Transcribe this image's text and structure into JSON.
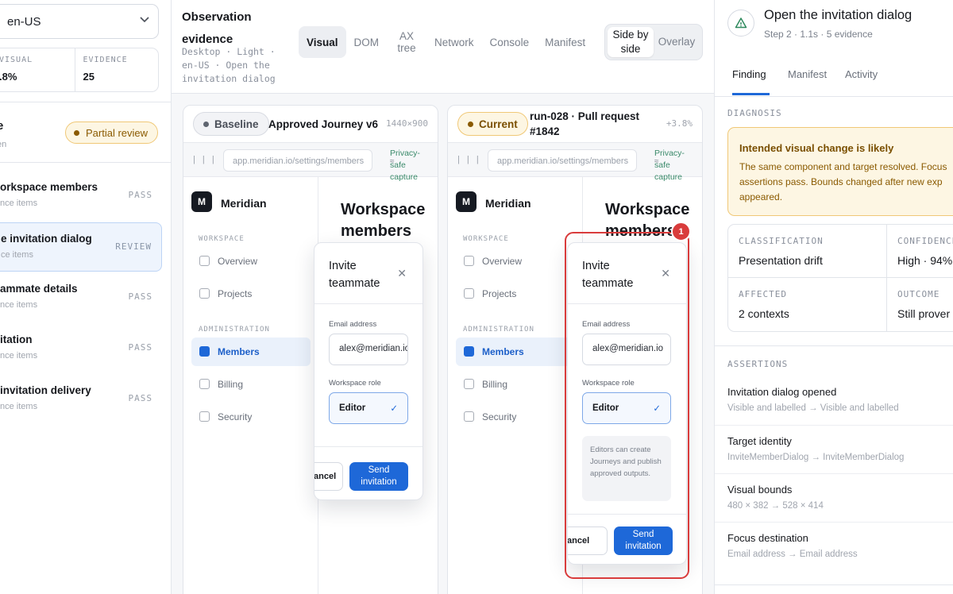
{
  "left": {
    "locale": "en-US",
    "stats": [
      {
        "label": "VISUAL",
        "value": ".8%"
      },
      {
        "label": "EVIDENCE",
        "value": "25"
      }
    ],
    "journey_title": "e",
    "journey_subtitle": "en",
    "review_status": "Partial review",
    "steps": [
      {
        "title": "orkspace members",
        "subtitle": "nce items",
        "status": "PASS"
      },
      {
        "title": "e invitation dialog",
        "subtitle": "ce items",
        "status": "REVIEW"
      },
      {
        "title": "ammate details",
        "subtitle": "nce items",
        "status": "PASS"
      },
      {
        "title": "itation",
        "subtitle": "nce items",
        "status": "PASS"
      },
      {
        "title": "invitation delivery",
        "subtitle": "nce items",
        "status": "PASS"
      }
    ]
  },
  "center": {
    "title": "Observation evidence",
    "meta": "Desktop · Light · en-US · Open the invitation dialog",
    "tabs": [
      "Visual",
      "DOM",
      "AX tree",
      "Network",
      "Console",
      "Manifest"
    ],
    "view_modes": [
      "Side by side",
      "Overlay"
    ],
    "baseline": {
      "badge": "Baseline",
      "label": "Approved Journey v6",
      "dims": "1440×900"
    },
    "current": {
      "badge": "Current",
      "label": "run-028 · Pull request #1842",
      "delta": "+3.8%"
    },
    "url": "app.meridian.io/settings/members",
    "privacy": "Privacy-safe capture",
    "app": {
      "brand_letter": "M",
      "brand": "Meridian",
      "sections": [
        "WORKSPACE",
        "ADMINISTRATION"
      ],
      "nav": [
        "Overview",
        "Projects",
        "Members",
        "Billing",
        "Security"
      ],
      "page_title": "Workspace members"
    },
    "modal": {
      "title": "Invite teammate",
      "email_label": "Email address",
      "email_value": "alex@meridian.io",
      "role_label": "Workspace role",
      "role_value": "Editor",
      "help_text": "Editors can create Journeys and publish approved outputs.",
      "cancel": "ancel",
      "send": "Send invitation"
    },
    "diff_marker": "1"
  },
  "right": {
    "title": "Open the invitation dialog",
    "subtitle": "Step 2 · 1.1s · 5 evidence",
    "tabs": [
      "Finding",
      "Manifest",
      "Activity"
    ],
    "diagnosis_label": "DIAGNOSIS",
    "callout_title": "Intended visual change is likely",
    "callout_body": "The same component and target resolved. Focus assertions pass. Bounds changed after new exp appeared.",
    "metrics": [
      {
        "label": "CLASSIFICATION",
        "value": "Presentation drift"
      },
      {
        "label": "CONFIDENCE",
        "value": "High · 94%"
      },
      {
        "label": "AFFECTED",
        "value": "2 contexts"
      },
      {
        "label": "OUTCOME",
        "value": "Still prover"
      }
    ],
    "assertions_label": "ASSERTIONS",
    "assertions": [
      {
        "title": "Invitation dialog opened",
        "detail": "Visible and labelled → Visible and labelled"
      },
      {
        "title": "Target identity",
        "detail": "InviteMemberDialog → InviteMemberDialog"
      },
      {
        "title": "Visual bounds",
        "detail": "480 × 382 → 528 × 414"
      },
      {
        "title": "Focus destination",
        "detail": "Email address → Email address"
      }
    ]
  },
  "colors": {
    "accent": "#1e68d8",
    "warning_bg": "#fdf6e3",
    "warning_border": "#f0c877",
    "diff_red": "#d93c3c"
  }
}
